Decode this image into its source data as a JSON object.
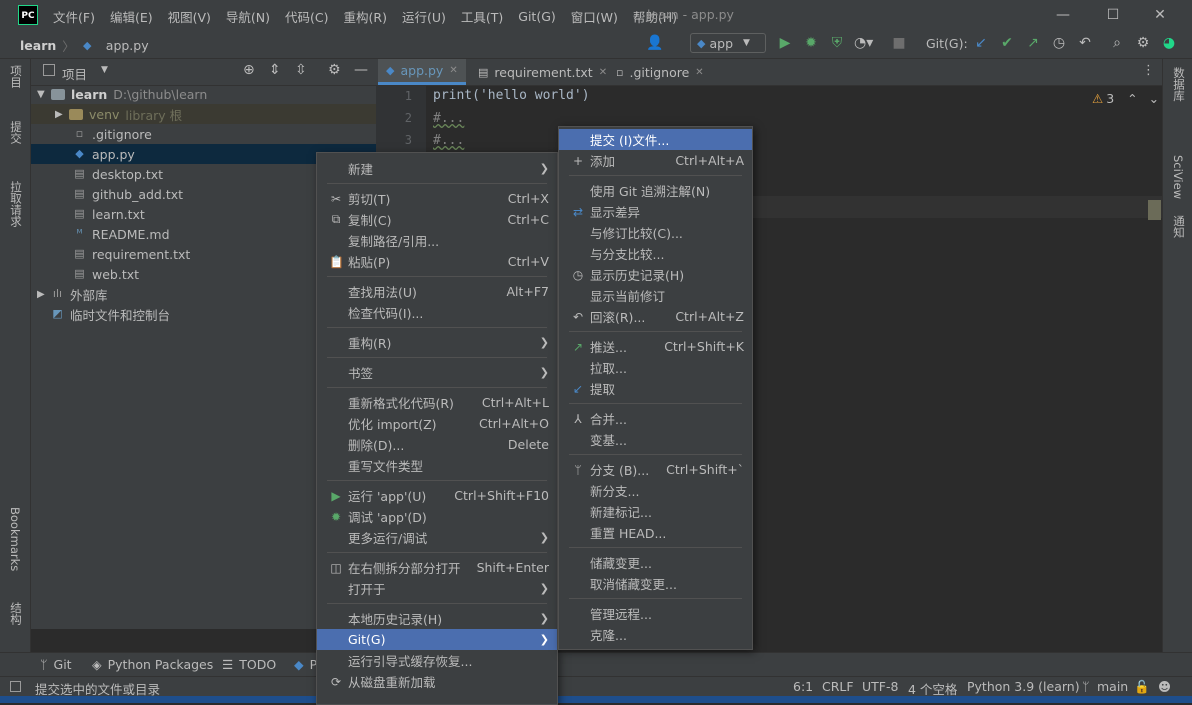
{
  "app": {
    "logo": "PC",
    "window_title": "learn - app.py"
  },
  "menubar": [
    "文件(F)",
    "编辑(E)",
    "视图(V)",
    "导航(N)",
    "代码(C)",
    "重构(R)",
    "运行(U)",
    "工具(T)",
    "Git(G)",
    "窗口(W)",
    "帮助(H)"
  ],
  "breadcrumb": {
    "project": "learn",
    "file": "app.py"
  },
  "toolbar": {
    "run_config": "app",
    "git_label": "Git(G):"
  },
  "left_stripe": [
    "项目",
    "提交",
    "拉取请求",
    "Bookmarks",
    "结构"
  ],
  "right_stripe": [
    "数据库",
    "SciView",
    "通知"
  ],
  "project_panel": {
    "title": "项目",
    "root": {
      "name": "learn",
      "path": "D:\\github\\learn"
    },
    "venv": {
      "name": "venv",
      "hint": "library 根"
    },
    "files": [
      ".gitignore",
      "app.py",
      "desktop.txt",
      "github_add.txt",
      "learn.txt",
      "README.md",
      "requirement.txt",
      "web.txt"
    ],
    "external": "外部库",
    "scratch": "临时文件和控制台"
  },
  "tabs": [
    "app.py",
    "requirement.txt",
    ".gitignore"
  ],
  "editor": {
    "line_numbers": [
      "1",
      "2",
      "3"
    ],
    "lines": [
      "print('hello world')",
      "#...",
      "#..."
    ],
    "warning_count": "3"
  },
  "context_menu": [
    {
      "label": "新建",
      "submenu": true
    },
    {
      "sep": true
    },
    {
      "label": "剪切(T)",
      "shortcut": "Ctrl+X",
      "icon": "cut-icon"
    },
    {
      "label": "复制(C)",
      "shortcut": "Ctrl+C",
      "icon": "copy-icon"
    },
    {
      "label": "复制路径/引用..."
    },
    {
      "label": "粘贴(P)",
      "shortcut": "Ctrl+V",
      "icon": "paste-icon"
    },
    {
      "sep": true
    },
    {
      "label": "查找用法(U)",
      "shortcut": "Alt+F7"
    },
    {
      "label": "检查代码(I)..."
    },
    {
      "sep": true
    },
    {
      "label": "重构(R)",
      "submenu": true
    },
    {
      "sep": true
    },
    {
      "label": "书签",
      "submenu": true
    },
    {
      "sep": true
    },
    {
      "label": "重新格式化代码(R)",
      "shortcut": "Ctrl+Alt+L"
    },
    {
      "label": "优化 import(Z)",
      "shortcut": "Ctrl+Alt+O"
    },
    {
      "label": "删除(D)...",
      "shortcut": "Delete"
    },
    {
      "label": "重写文件类型"
    },
    {
      "sep": true
    },
    {
      "label": "运行 'app'(U)",
      "shortcut": "Ctrl+Shift+F10",
      "icon": "run-icon"
    },
    {
      "label": "调试 'app'(D)",
      "icon": "debug-icon"
    },
    {
      "label": "更多运行/调试",
      "submenu": true
    },
    {
      "sep": true
    },
    {
      "label": "在右侧拆分部分打开",
      "shortcut": "Shift+Enter",
      "icon": "split-icon"
    },
    {
      "label": "打开于",
      "submenu": true
    },
    {
      "sep": true
    },
    {
      "label": "本地历史记录(H)",
      "submenu": true
    },
    {
      "label": "Git(G)",
      "submenu": true,
      "highlight": true
    },
    {
      "label": "运行引导式缓存恢复..."
    },
    {
      "label": "从磁盘重新加载",
      "icon": "reload-icon"
    }
  ],
  "git_submenu": [
    {
      "label": "提交 (I)文件...",
      "highlight": true
    },
    {
      "label": "添加",
      "shortcut": "Ctrl+Alt+A",
      "icon": "plus-icon"
    },
    {
      "sep": true
    },
    {
      "label": "使用 Git 追溯注解(N)"
    },
    {
      "label": "显示差异",
      "icon": "diff-icon"
    },
    {
      "label": "与修订比较(C)..."
    },
    {
      "label": "与分支比较..."
    },
    {
      "label": "显示历史记录(H)",
      "icon": "history-icon"
    },
    {
      "label": "显示当前修订"
    },
    {
      "label": "回滚(R)...",
      "shortcut": "Ctrl+Alt+Z",
      "icon": "rollback-icon"
    },
    {
      "sep": true
    },
    {
      "label": "推送...",
      "shortcut": "Ctrl+Shift+K",
      "icon": "push-icon"
    },
    {
      "label": "拉取..."
    },
    {
      "label": "提取",
      "icon": "fetch-icon"
    },
    {
      "sep": true
    },
    {
      "label": "合并...",
      "icon": "merge-icon"
    },
    {
      "label": "变基..."
    },
    {
      "sep": true
    },
    {
      "label": "分支 (B)...",
      "shortcut": "Ctrl+Shift+`",
      "icon": "branch-icon"
    },
    {
      "label": "新分支..."
    },
    {
      "label": "新建标记..."
    },
    {
      "label": "重置 HEAD..."
    },
    {
      "sep": true
    },
    {
      "label": "储藏变更..."
    },
    {
      "label": "取消储藏变更..."
    },
    {
      "sep": true
    },
    {
      "label": "管理远程..."
    },
    {
      "label": "克隆..."
    }
  ],
  "bottom_tools": [
    "Git",
    "Python Packages",
    "TODO",
    "P"
  ],
  "status": {
    "message": "提交选中的文件或目录",
    "position": "6:1",
    "line_sep": "CRLF",
    "encoding": "UTF-8",
    "indent": "4 个空格",
    "interpreter": "Python 3.9 (learn)",
    "branch": "main"
  },
  "colors": {
    "accent": "#4b6eaf",
    "run_green": "#59a869",
    "bg": "#2b2b2b",
    "panel": "#3c3f41"
  }
}
